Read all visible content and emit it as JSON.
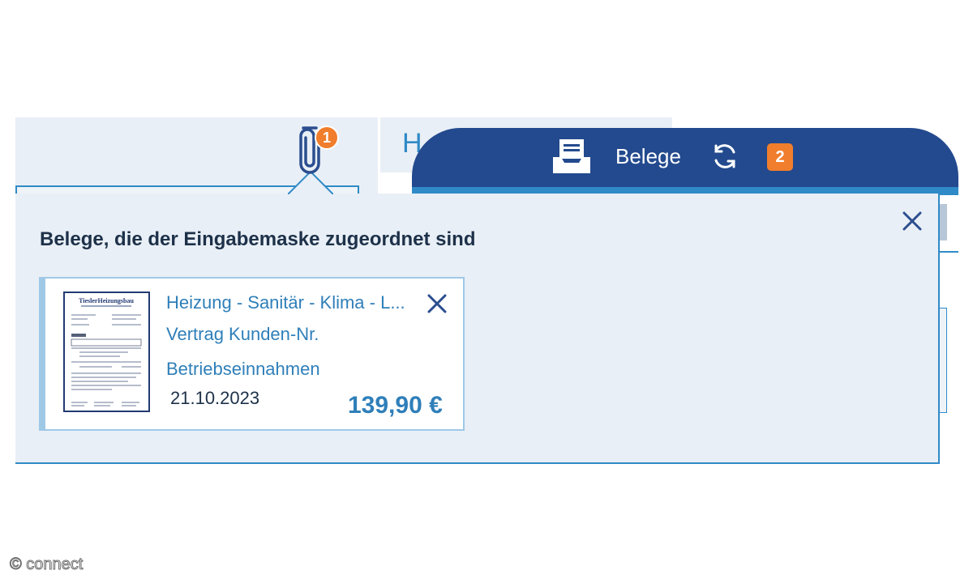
{
  "background_window": {
    "title_fragment": "H",
    "attachment_badge_count": "1",
    "icons": [
      "paperclip-icon"
    ]
  },
  "belege_window": {
    "title": "Belege",
    "pending_badge_count": "2",
    "icons": [
      "inbox-icon",
      "sync-icon"
    ],
    "header_color": "#234a8e",
    "accent_color": "#2f8ac7"
  },
  "popover": {
    "title": "Belege, die der Eingabemaske zugeordnet sind",
    "close_icon": "close-icon"
  },
  "receipt": {
    "line1": "Heizung - Sanitär - Klima - L...",
    "line2": "Vertrag Kunden-Nr.",
    "category": "Betriebseinnahmen",
    "date": "21.10.2023",
    "amount": "139,90 €",
    "thumbnail_header": "TieslerHeizungsbau",
    "remove_icon": "close-icon",
    "badge_color": "#f07e2c"
  },
  "watermark": "© connect"
}
